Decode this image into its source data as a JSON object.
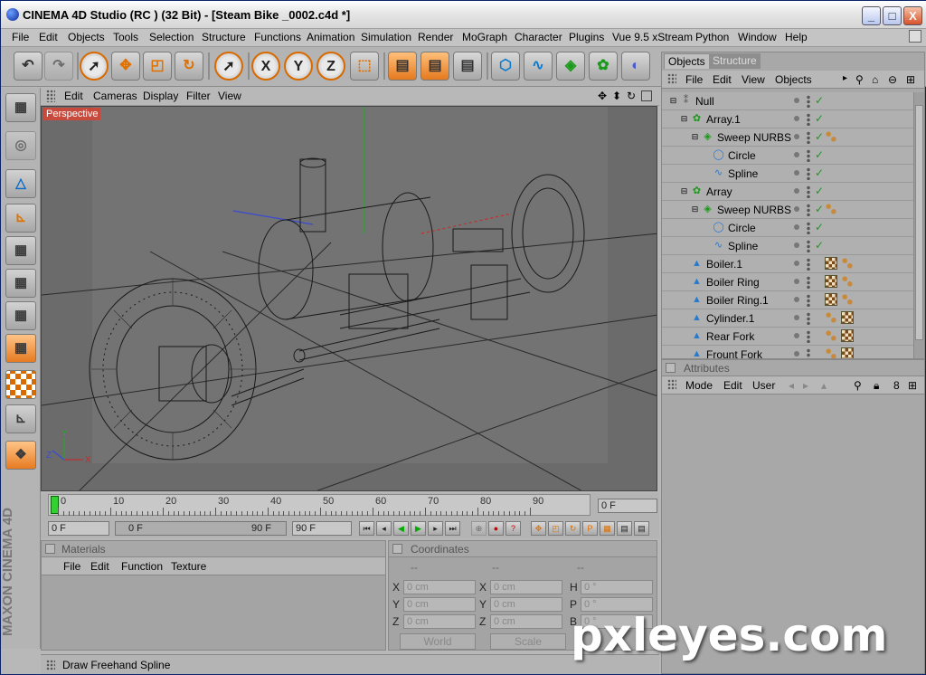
{
  "window": {
    "title": "CINEMA 4D Studio (RC ) (32 Bit) - [Steam Bike _0002.c4d *]",
    "minimize_label": "_",
    "maximize_label": "□",
    "close_label": "X"
  },
  "menu": [
    "File",
    "Edit",
    "Objects",
    "Tools",
    "Selection",
    "Structure",
    "Functions",
    "Animation",
    "Simulation",
    "Render",
    "MoGraph",
    "Character",
    "Plugins",
    "Vue 9.5 xStream",
    "Python",
    "Window",
    "Help"
  ],
  "toolbar": {
    "x_label": "X",
    "y_label": "Y",
    "z_label": "Z"
  },
  "viewport": {
    "menu": [
      "Edit",
      "Cameras",
      "Display",
      "Filter",
      "View"
    ],
    "label": "Perspective",
    "axis_x": "X",
    "axis_y": "Y",
    "axis_z": "Z"
  },
  "timeline": {
    "ticks": [
      "0",
      "10",
      "20",
      "30",
      "40",
      "50",
      "60",
      "70",
      "80",
      "90"
    ],
    "current_frame": "0 F",
    "start_frame": "0 F",
    "range_start": "0 F",
    "range_end": "90 F",
    "end_frame": "90 F"
  },
  "materials": {
    "title": "Materials",
    "menu": [
      "File",
      "Edit",
      "Function",
      "Texture"
    ]
  },
  "coordinates": {
    "title": "Coordinates",
    "col_heads": [
      "--",
      "--",
      "--"
    ],
    "rows": [
      {
        "a": "X",
        "av": "0 cm",
        "b": "X",
        "bv": "0 cm",
        "c": "H",
        "cv": "0 °"
      },
      {
        "a": "Y",
        "av": "0 cm",
        "b": "Y",
        "bv": "0 cm",
        "c": "P",
        "cv": "0 °"
      },
      {
        "a": "Z",
        "av": "0 cm",
        "b": "Z",
        "bv": "0 cm",
        "c": "B",
        "cv": "0 °"
      }
    ],
    "world": "World",
    "scale": "Scale"
  },
  "status": "Draw Freehand Spline",
  "objects_panel": {
    "tab_objects": "Objects",
    "tab_structure": "Structure",
    "menu": [
      "File",
      "Edit",
      "View",
      "Objects"
    ],
    "items": [
      {
        "name": "Null",
        "depth": 0,
        "icon": "null",
        "tags": []
      },
      {
        "name": "Array.1",
        "depth": 1,
        "icon": "array",
        "tags": []
      },
      {
        "name": "Sweep NURBS",
        "depth": 2,
        "icon": "sweep",
        "tags": [
          "bl"
        ]
      },
      {
        "name": "Circle",
        "depth": 3,
        "icon": "circle",
        "tags": []
      },
      {
        "name": "Spline",
        "depth": 3,
        "icon": "spline",
        "tags": []
      },
      {
        "name": "Array",
        "depth": 1,
        "icon": "array",
        "tags": []
      },
      {
        "name": "Sweep NURBS",
        "depth": 2,
        "icon": "sweep",
        "tags": [
          "bl"
        ]
      },
      {
        "name": "Circle",
        "depth": 3,
        "icon": "circle",
        "tags": []
      },
      {
        "name": "Spline",
        "depth": 3,
        "icon": "spline",
        "tags": []
      },
      {
        "name": "Boiler.1",
        "depth": 1,
        "icon": "cone",
        "tags": [
          "ck",
          "bl"
        ]
      },
      {
        "name": "Boiler Ring",
        "depth": 1,
        "icon": "cone",
        "tags": [
          "ck",
          "bl"
        ]
      },
      {
        "name": "Boiler Ring.1",
        "depth": 1,
        "icon": "cone",
        "tags": [
          "ck",
          "bl"
        ]
      },
      {
        "name": "Cylinder.1",
        "depth": 1,
        "icon": "cone",
        "tags": [
          "bl",
          "ck"
        ]
      },
      {
        "name": "Rear Fork",
        "depth": 1,
        "icon": "cone",
        "tags": [
          "bl",
          "ck"
        ]
      },
      {
        "name": "Frount Fork",
        "depth": 1,
        "icon": "cone",
        "tags": [
          "bl",
          "ck"
        ]
      }
    ]
  },
  "attributes": {
    "title": "Attributes",
    "menu": [
      "Mode",
      "Edit",
      "User"
    ]
  },
  "maxon_logo": "MAXON CINEMA 4D",
  "watermark": "pxleyes.com"
}
